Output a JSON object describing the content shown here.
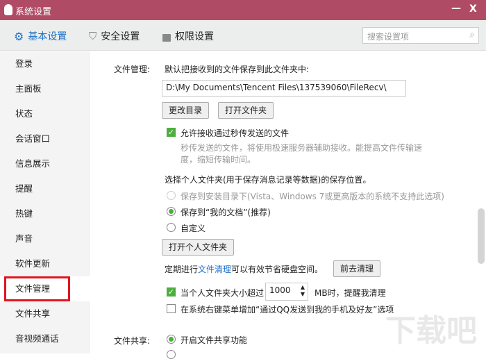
{
  "window": {
    "title": "系统设置",
    "minimize": "—",
    "close": "X"
  },
  "tabs": [
    {
      "label": "基本设置",
      "icon": "gear-icon"
    },
    {
      "label": "安全设置",
      "icon": "shield-icon"
    },
    {
      "label": "权限设置",
      "icon": "lock-icon"
    }
  ],
  "search": {
    "placeholder": "搜索设置项"
  },
  "sidebar": {
    "items": [
      "登录",
      "主面板",
      "状态",
      "会话窗口",
      "信息展示",
      "提醒",
      "热键",
      "声音",
      "软件更新",
      "文件管理",
      "文件共享",
      "音视频通话"
    ],
    "selected": "文件管理"
  },
  "file_mgmt": {
    "label": "文件管理:",
    "default_desc": "默认把接收到的文件保存到此文件夹中:",
    "path": "D:\\My Documents\\Tencent Files\\137539060\\FileRecv\\",
    "change_dir": "更改目录",
    "open_folder": "打开文件夹",
    "allow_fast": "允许接收通过秒传发送的文件",
    "fast_desc1": "秒传发送的文件，将使用极速服务器辅助接收。能提高文件传输速",
    "fast_desc2": "度，缩短传输时间。",
    "personal_title": "选择个人文件夹(用于保存消息记录等数据)的保存位置。",
    "opt_install": "保存到安装目录下(Vista、Windows 7或更高版本的系统不支持此选项)",
    "opt_mydocs": "保存到“我的文档”(推荐)",
    "opt_custom": "自定义",
    "open_personal": "打开个人文件夹",
    "clean_pre": "定期进行",
    "clean_link": "文件清理",
    "clean_post": "可以有效节省硬盘空间。",
    "clean_btn": "前去清理",
    "size_warn_pre": "当个人文件夹大小超过",
    "size_value": "1000",
    "size_warn_post": "MB时，提醒我清理",
    "context_menu": "在系统右键菜单增加“通过QQ发送到我的手机及好友”选项"
  },
  "file_share": {
    "label": "文件共享:",
    "enable": "开启文件共享功能"
  },
  "watermark": "下载吧"
}
